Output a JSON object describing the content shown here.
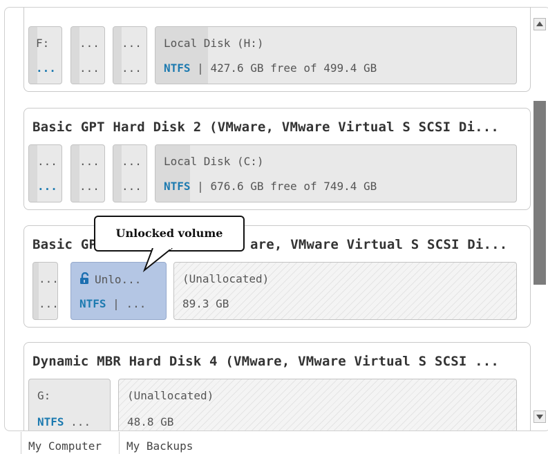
{
  "disks": [
    {
      "title": "",
      "partitions": [
        {
          "l1": "F:",
          "l2": "..."
        },
        {
          "l1": "...",
          "l2": "..."
        },
        {
          "l1": "...",
          "l2": "..."
        },
        {
          "name": "Local Disk (H:)",
          "fs": "NTFS",
          "sep": "|",
          "info": "427.6 GB free of 499.4 GB"
        }
      ]
    },
    {
      "title": "Basic GPT Hard Disk 2 (VMware, VMware Virtual S SCSI Di...",
      "partitions": [
        {
          "l1": "...",
          "l2": "..."
        },
        {
          "l1": "...",
          "l2": "..."
        },
        {
          "l1": "...",
          "l2": "..."
        },
        {
          "name": "Local Disk (C:)",
          "fs": "NTFS",
          "sep": "|",
          "info": "676.6 GB free of 749.4 GB"
        }
      ]
    },
    {
      "title_start": "Basic GP",
      "title_end": "are, VMware Virtual S SCSI Di...",
      "partitions": [
        {
          "l1": "...",
          "l2": "..."
        },
        {
          "icon": "unlocked-padlock-icon",
          "name": "Unlo...",
          "fs": "NTFS",
          "sep": "|",
          "info": "..."
        },
        {
          "name": "(Unallocated)",
          "size": "89.3 GB"
        }
      ]
    },
    {
      "title": "Dynamic MBR Hard Disk 4 (VMware, VMware Virtual S SCSI ...",
      "partitions": [
        {
          "l1": "G:",
          "fs": "NTFS",
          "info": "..."
        },
        {
          "name": "(Unallocated)",
          "size": "48.8 GB"
        }
      ]
    }
  ],
  "tooltip": {
    "text": "Unlocked volume"
  },
  "tabs": [
    {
      "label": "My Computer",
      "active": true
    },
    {
      "label": "My Backups",
      "active": false
    }
  ],
  "colors": {
    "fs_text": "#1c7ab0",
    "selected_partition": "#b4c6e4",
    "scrollbar_thumb": "#7c7c7c"
  }
}
